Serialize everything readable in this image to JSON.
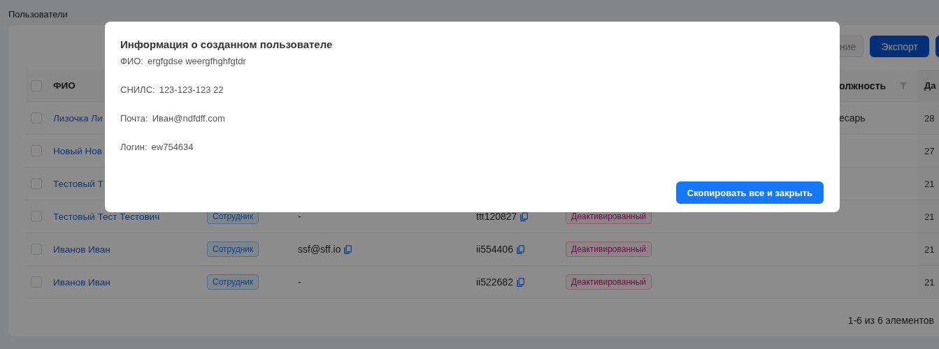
{
  "page_title": "Пользователи",
  "toolbar": {
    "buttons": [
      {
        "kind": "outline",
        "label": "ние"
      },
      {
        "kind": "primary",
        "label": "Экспорт"
      },
      {
        "kind": "primary"
      }
    ]
  },
  "table": {
    "select_all": {
      "checked": false
    },
    "columns": [
      {
        "kind": "name",
        "label": "ФИО"
      },
      {
        "kind": "position",
        "label": "олжность",
        "filter": true
      },
      {
        "kind": "date",
        "label": "Да",
        "sorted": true
      }
    ],
    "rows": [
      {
        "checked": false,
        "name": "Лизочка Ли",
        "position": "есарь",
        "date": "28"
      },
      {
        "checked": false,
        "name": "Новый Нов",
        "date": "27"
      },
      {
        "checked": false,
        "name": "Тестовый Т",
        "date": "21"
      },
      {
        "checked": false,
        "name": "Тестовый Тест Тестович",
        "role": "Сотрудник",
        "email": {
          "text": "-",
          "copyable": false
        },
        "login": {
          "text": "ttt120827",
          "copyable": true
        },
        "status": "Деактивированный",
        "date": "21"
      },
      {
        "checked": false,
        "name": "Иванов Иван",
        "role": "Сотрудник",
        "email": {
          "text": "ssf@sff.io",
          "copyable": true
        },
        "login": {
          "text": "ii554406",
          "copyable": true
        },
        "status": "Деактивированный",
        "date": "21"
      },
      {
        "checked": false,
        "name": "Иванов Иван",
        "role": "Сотрудник",
        "email": {
          "text": "-",
          "copyable": false
        },
        "login": {
          "text": "ii522682",
          "copyable": true
        },
        "status": "Деактивированный",
        "date": "21"
      }
    ]
  },
  "pagination": {
    "summary": "1-6 из 6 элементов"
  },
  "modal": {
    "title": "Информация о созданном пользователе",
    "fields": [
      {
        "label": "ФИО:",
        "value": "ergfgdse weergfhghfgtdr"
      },
      {
        "label": "СНИЛС:",
        "value": "123-123-123 22"
      },
      {
        "label": "Почта:",
        "value": "Иван@ndfdff.com"
      },
      {
        "label": "Логин:",
        "value": "ew754634"
      }
    ],
    "button": "Скопировать все и закрыть"
  }
}
